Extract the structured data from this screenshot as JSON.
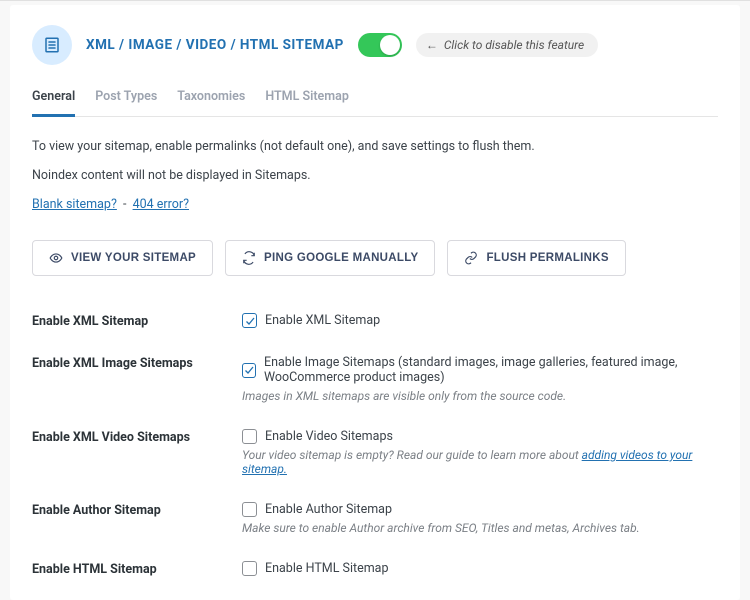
{
  "header": {
    "title": "XML / IMAGE / VIDEO / HTML SITEMAP",
    "disable_hint": "Click to disable this feature"
  },
  "tabs": [
    {
      "label": "General",
      "active": true
    },
    {
      "label": "Post Types",
      "active": false
    },
    {
      "label": "Taxonomies",
      "active": false
    },
    {
      "label": "HTML Sitemap",
      "active": false
    }
  ],
  "info": {
    "line1": "To view your sitemap, enable permalinks (not default one), and save settings to flush them.",
    "line2": "Noindex content will not be displayed in Sitemaps.",
    "link1": "Blank sitemap?",
    "link2": "404 error?",
    "dash": "-"
  },
  "actions": {
    "view": "VIEW YOUR SITEMAP",
    "ping": "PING GOOGLE MANUALLY",
    "flush": "FLUSH PERMALINKS"
  },
  "settings": {
    "xml": {
      "label": "Enable XML Sitemap",
      "option": "Enable XML Sitemap",
      "checked": true
    },
    "image": {
      "label": "Enable XML Image Sitemaps",
      "option": "Enable Image Sitemaps (standard images, image galleries, featured image, WooCommerce product images)",
      "checked": true,
      "help": "Images in XML sitemaps are visible only from the source code."
    },
    "video": {
      "label": "Enable XML Video Sitemaps",
      "option": "Enable Video Sitemaps",
      "checked": false,
      "help_pre": "Your video sitemap is empty? Read our guide to learn more about ",
      "help_link": "adding videos to your sitemap."
    },
    "author": {
      "label": "Enable Author Sitemap",
      "option": "Enable Author Sitemap",
      "checked": false,
      "help": "Make sure to enable Author archive from SEO, Titles and metas, Archives tab."
    },
    "htmlS": {
      "label": "Enable HTML Sitemap",
      "option": "Enable HTML Sitemap",
      "checked": false
    }
  }
}
